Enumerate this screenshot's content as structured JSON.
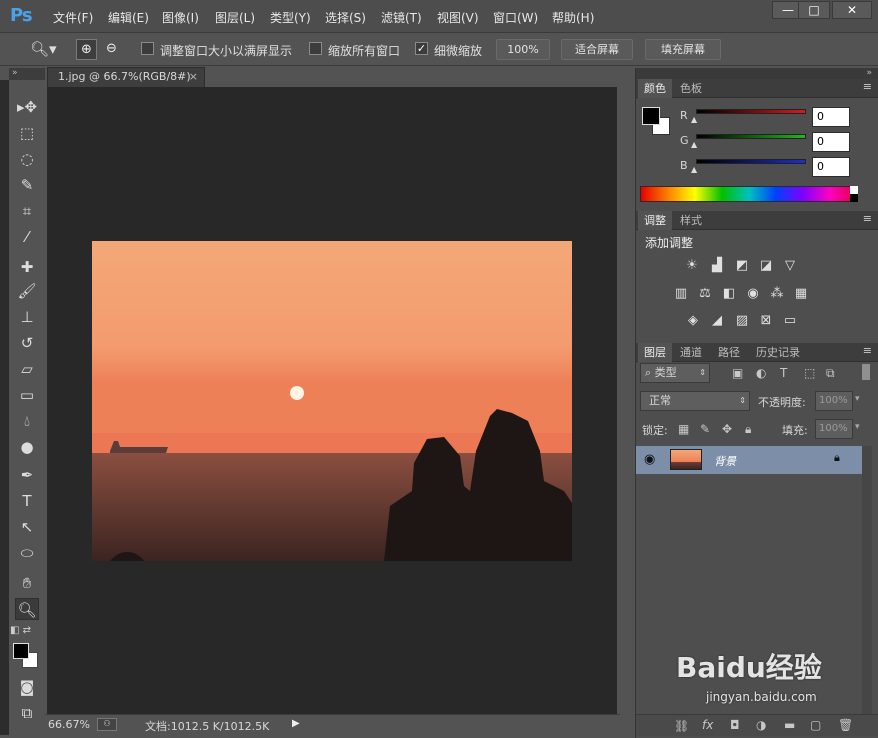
{
  "app": {
    "logo": "Ps"
  },
  "menu": [
    "文件(F)",
    "编辑(E)",
    "图像(I)",
    "图层(L)",
    "类型(Y)",
    "选择(S)",
    "滤镜(T)",
    "视图(V)",
    "窗口(W)",
    "帮助(H)"
  ],
  "window_controls": {
    "minimize": "—",
    "maximize": "□",
    "close": "✕"
  },
  "options": {
    "resize_windows": "调整窗口大小以满屏显示",
    "zoom_all": "缩放所有窗口",
    "scrubby_zoom": "细微缩放",
    "btn_100": "100%",
    "btn_fit": "适合屏幕",
    "btn_fill": "填充屏幕"
  },
  "document": {
    "tab_title": "1.jpg @ 66.7%(RGB/8#)",
    "zoom": "66.67%",
    "doc_info": "文档:1012.5 K/1012.5K"
  },
  "color_panel": {
    "tabs": [
      "颜色",
      "色板"
    ],
    "channels": [
      {
        "label": "R",
        "value": "0",
        "color": "#d01e1e"
      },
      {
        "label": "G",
        "value": "0",
        "color": "#1eb81e"
      },
      {
        "label": "B",
        "value": "0",
        "color": "#1e2ecc"
      }
    ]
  },
  "adjust_panel": {
    "tabs": [
      "调整",
      "样式"
    ],
    "title": "添加调整"
  },
  "layers_panel": {
    "tabs": [
      "图层",
      "通道",
      "路径",
      "历史记录"
    ],
    "filter": "类型",
    "blend_mode": "正常",
    "opacity_label": "不透明度:",
    "opacity_value": "100%",
    "lock_label": "锁定:",
    "fill_label": "填充:",
    "fill_value": "100%",
    "layers": [
      {
        "name": "背景"
      }
    ]
  },
  "watermark": {
    "brand": "Baidu经验",
    "url": "jingyan.baidu.com"
  }
}
